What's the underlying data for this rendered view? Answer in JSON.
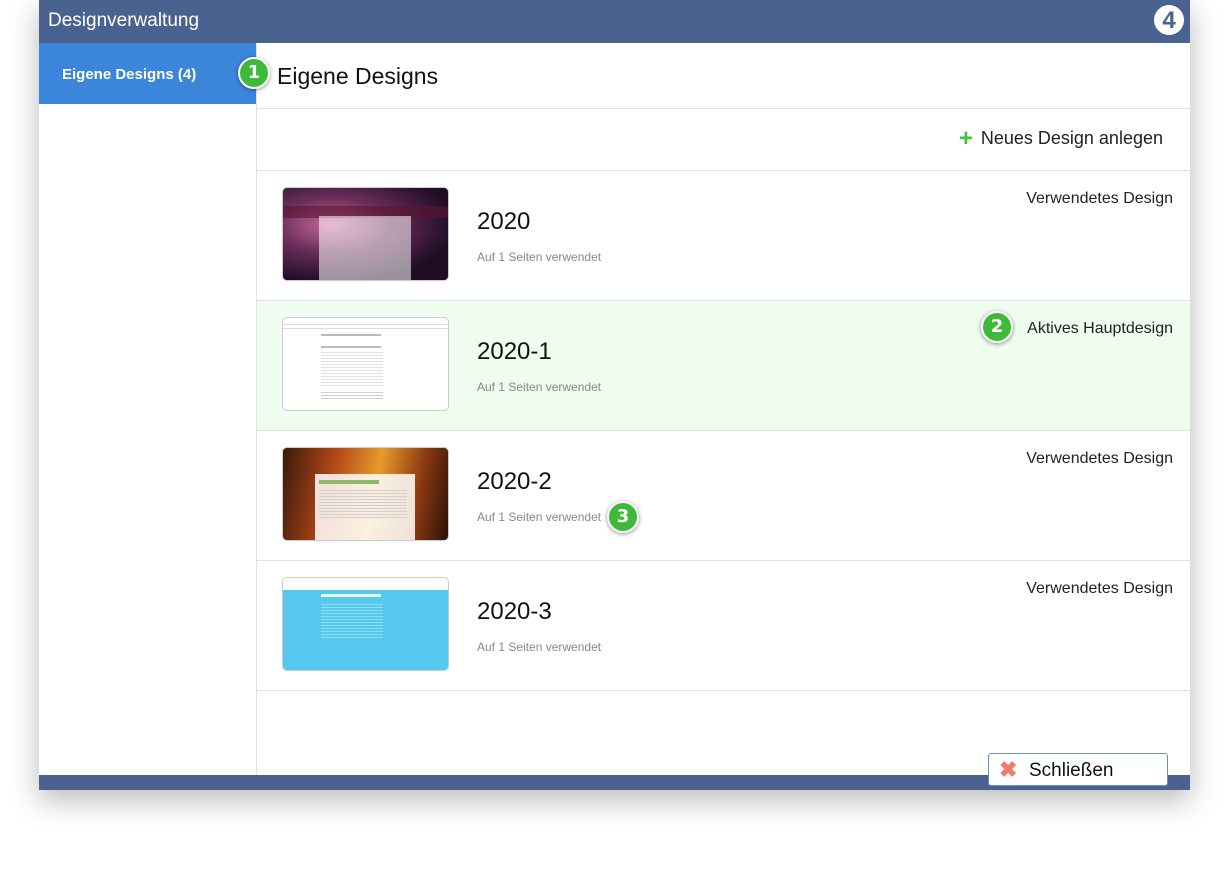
{
  "window": {
    "title": "Designverwaltung",
    "logo_text": "4"
  },
  "sidebar": {
    "items": [
      {
        "label": "Eigene Designs (4)"
      }
    ]
  },
  "main": {
    "title": "Eigene Designs",
    "new_design_label": "Neues Design anlegen",
    "designs": [
      {
        "name": "2020",
        "usage": "Auf 1 Seiten verwendet",
        "status": "Verwendetes Design",
        "thumbnail": "space-nebula"
      },
      {
        "name": "2020-1",
        "usage": "Auf 1 Seiten verwendet",
        "status": "Aktives Hauptdesign",
        "thumbnail": "white-text-page"
      },
      {
        "name": "2020-2",
        "usage": "Auf 1 Seiten verwendet",
        "status": "Verwendetes Design",
        "thumbnail": "autumn-forest"
      },
      {
        "name": "2020-3",
        "usage": "Auf 1 Seiten verwendet",
        "status": "Verwendetes Design",
        "thumbnail": "light-blue-page"
      }
    ]
  },
  "callouts": [
    "1",
    "2",
    "3"
  ],
  "footer": {
    "close_label": "Schließen"
  },
  "colors": {
    "titlebar": "#4a628f",
    "sidebar_active": "#3b86db",
    "active_row": "#eefdee",
    "badge": "#3fb93a",
    "plus": "#43c23d",
    "close_x": "#f07c6e"
  }
}
